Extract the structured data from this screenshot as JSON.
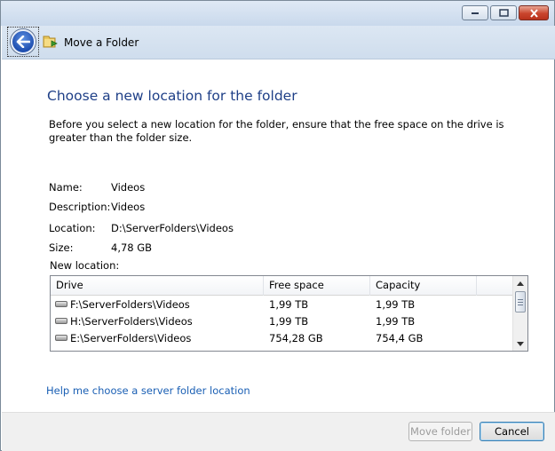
{
  "window": {
    "title": "Move a Folder"
  },
  "page": {
    "heading": "Choose a new location for the folder",
    "intro": "Before you select a new location for the folder, ensure that the free space on the drive is greater than the folder size."
  },
  "details": {
    "name_label": "Name:",
    "name_value": "Videos",
    "description_label": "Description:",
    "description_value": "Videos",
    "location_label": "Location:",
    "location_value": "D:\\ServerFolders\\Videos",
    "size_label": "Size:",
    "size_value": "4,78 GB"
  },
  "new_location": {
    "label": "New location:",
    "columns": [
      "Drive",
      "Free space",
      "Capacity"
    ],
    "rows": [
      {
        "drive": "F:\\ServerFolders\\Videos",
        "free": "1,99 TB",
        "capacity": "1,99 TB"
      },
      {
        "drive": "H:\\ServerFolders\\Videos",
        "free": "1,99 TB",
        "capacity": "1,99 TB"
      },
      {
        "drive": "E:\\ServerFolders\\Videos",
        "free": "754,28 GB",
        "capacity": "754,4 GB"
      }
    ]
  },
  "help_link": "Help me choose a server folder location",
  "buttons": {
    "move": "Move folder",
    "cancel": "Cancel"
  },
  "colors": {
    "heading": "#1e3f87",
    "link": "#1a5fb4"
  }
}
